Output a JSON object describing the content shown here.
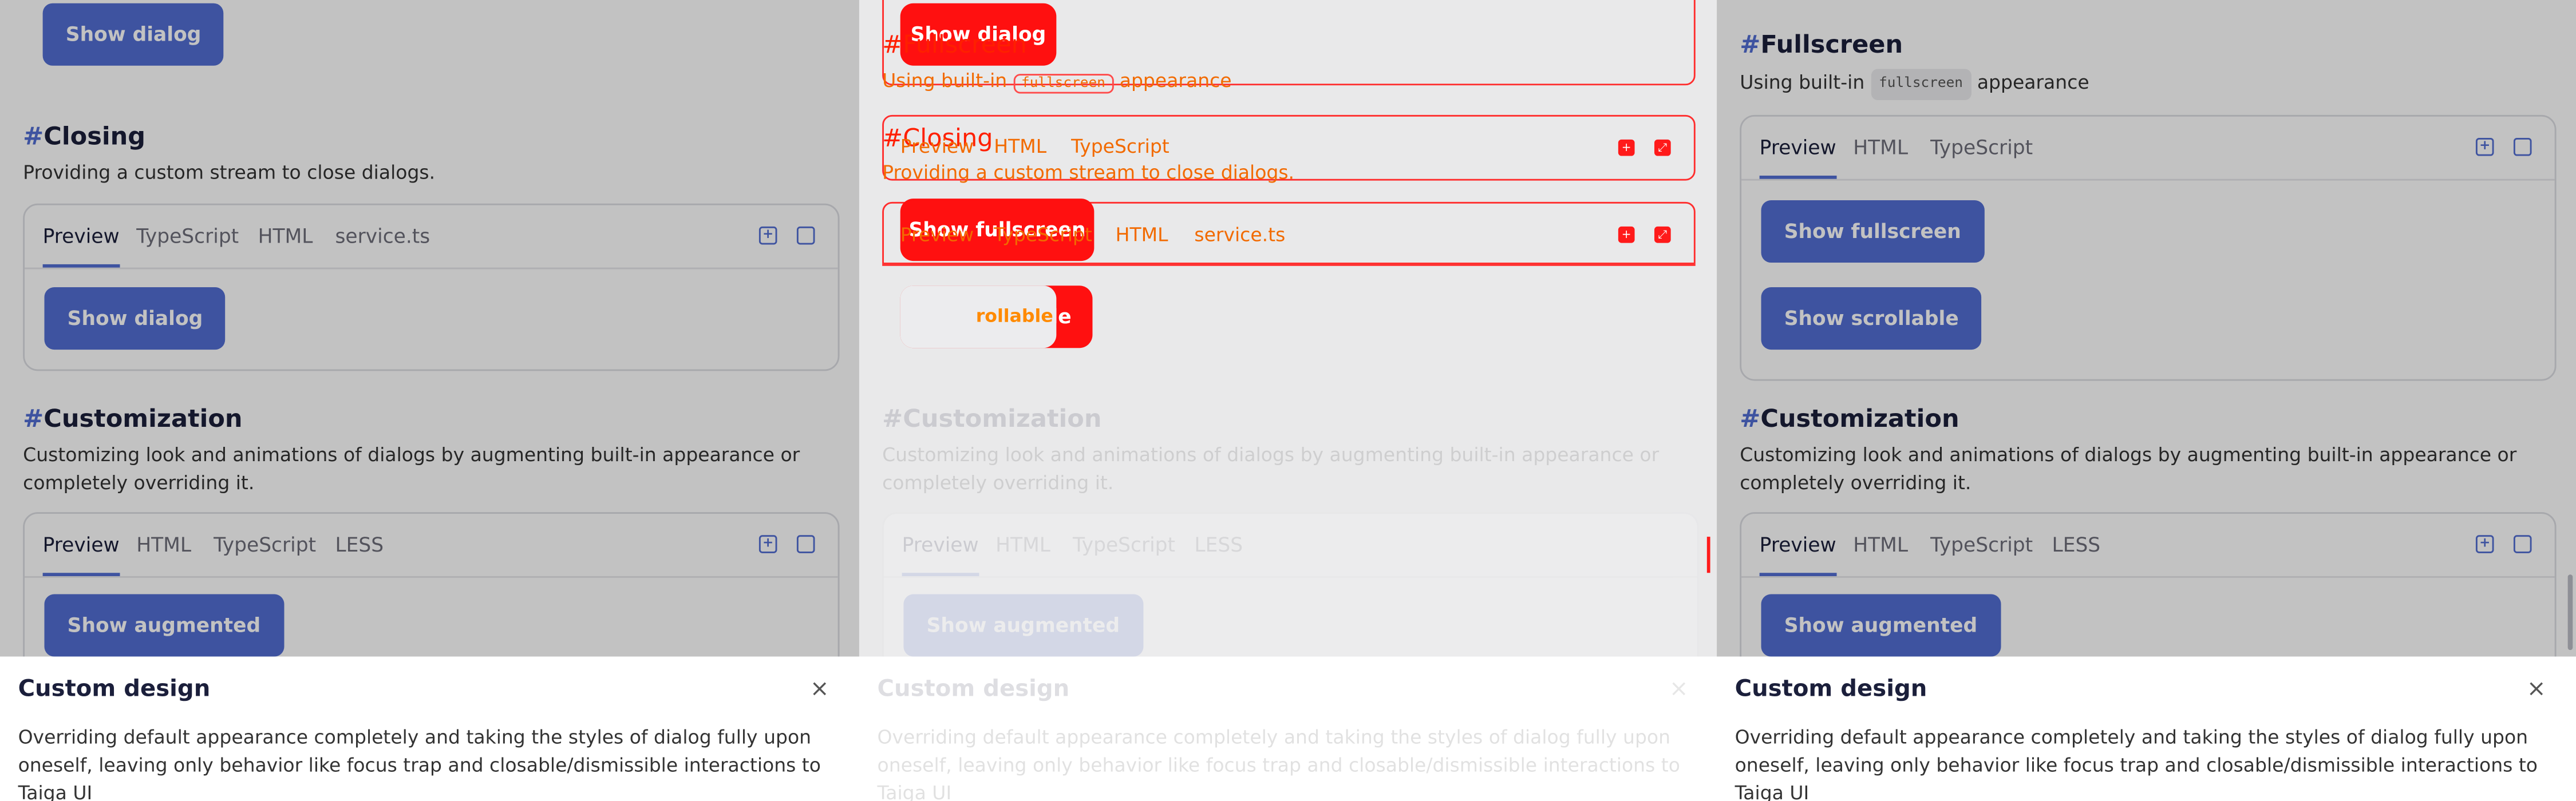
{
  "sections": {
    "fullscreen": {
      "hash": "#",
      "title": "Fullscreen",
      "desc_prefix": "Using built-in",
      "desc_code": "fullscreen",
      "desc_suffix": "appearance"
    },
    "closing": {
      "hash": "#",
      "title": "Closing",
      "desc": "Providing a custom stream to close dialogs."
    },
    "customization": {
      "hash": "#",
      "title": "Customization",
      "desc": "Customizing look and animations of dialogs by augmenting built-in appearance or completely overriding it."
    }
  },
  "tabs": {
    "preview": "Preview",
    "html": "HTML",
    "typescript": "TypeScript",
    "less": "LESS",
    "service": "service.ts"
  },
  "buttons": {
    "show_dialog": "Show dialog",
    "show_fullscreen": "Show fullscreen",
    "show_scrollable": "Show scrollable",
    "show_augmented": "Show augmented"
  },
  "overlay_labels": {
    "scrollable_fragment": "rollable"
  },
  "dialog": {
    "title": "Custom design",
    "close_icon": "×",
    "body": "Overriding default appearance completely and taking the styles of dialog fully upon oneself, leaving only behavior like focus trap and closable/dismissible interactions to Taiga UI"
  },
  "icons": {
    "open": "open-in-new-icon",
    "expand": "expand-icon",
    "close": "close-icon"
  },
  "colors": {
    "accent": "#526ed3",
    "highlight": "#ff1010",
    "overlay_text": "#f26a00"
  }
}
